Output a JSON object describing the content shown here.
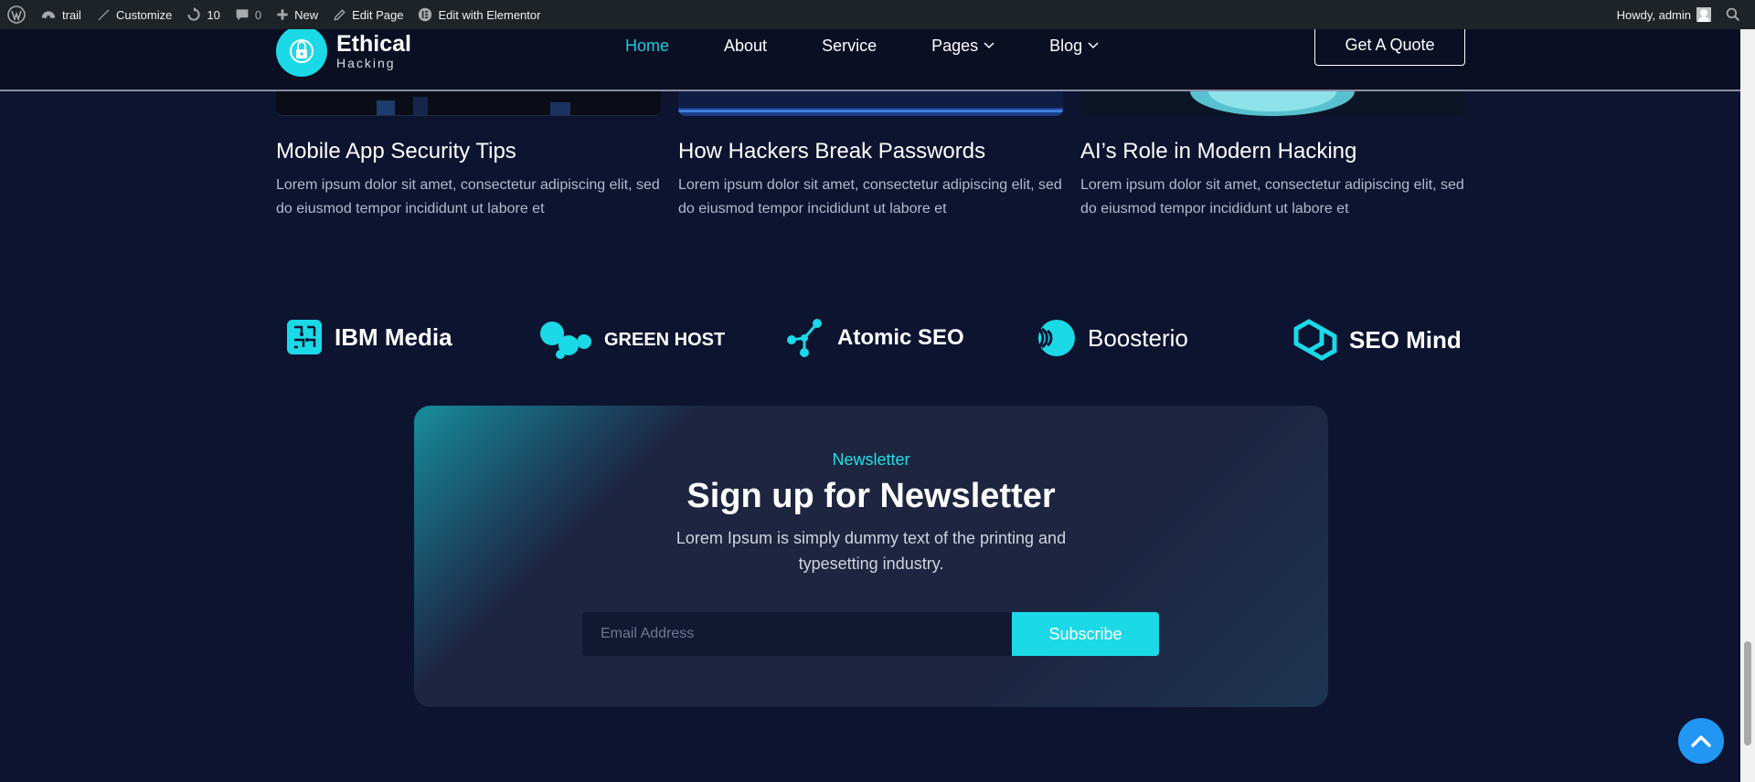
{
  "admin_bar": {
    "site_name": "trail",
    "customize": "Customize",
    "updates_count": "10",
    "comments_count": "0",
    "new": "New",
    "edit_page": "Edit Page",
    "edit_elementor": "Edit with Elementor",
    "howdy": "Howdy, admin"
  },
  "header": {
    "logo_title": "Ethical",
    "logo_subtitle": "Hacking",
    "nav": [
      {
        "label": "Home",
        "active": true
      },
      {
        "label": "About"
      },
      {
        "label": "Service"
      },
      {
        "label": "Pages",
        "dropdown": true
      },
      {
        "label": "Blog",
        "dropdown": true
      }
    ],
    "cta": "Get A Quote"
  },
  "blog_cards": [
    {
      "title": "Mobile App Security Tips",
      "excerpt": "Lorem ipsum dolor sit amet, consectetur adipiscing elit, sed do eiusmod tempor incididunt ut labore et"
    },
    {
      "title": "How Hackers Break Passwords",
      "excerpt": "Lorem ipsum dolor sit amet, consectetur adipiscing elit, sed do eiusmod tempor incididunt ut labore et"
    },
    {
      "title": "AI’s Role in Modern Hacking",
      "excerpt": "Lorem ipsum dolor sit amet, consectetur adipiscing elit, sed do eiusmod tempor incididunt ut labore et"
    }
  ],
  "brands": [
    {
      "name": "IBM Media",
      "icon": "circuit-icon"
    },
    {
      "name": "GREEN HOST",
      "icon": "blob-icon"
    },
    {
      "name": "Atomic SEO",
      "icon": "molecule-icon"
    },
    {
      "name": "Boosterio",
      "icon": "waves-icon"
    },
    {
      "name": "SEO Mind",
      "icon": "hexagon-icon"
    }
  ],
  "newsletter": {
    "tag": "Newsletter",
    "title": "Sign up for Newsletter",
    "description": "Lorem Ipsum is simply dummy text of the printing and typesetting industry.",
    "email_placeholder": "Email Address",
    "button": "Subscribe"
  },
  "colors": {
    "accent": "#1bd9e6",
    "background": "#0d1430",
    "back_to_top": "#2196f3"
  }
}
